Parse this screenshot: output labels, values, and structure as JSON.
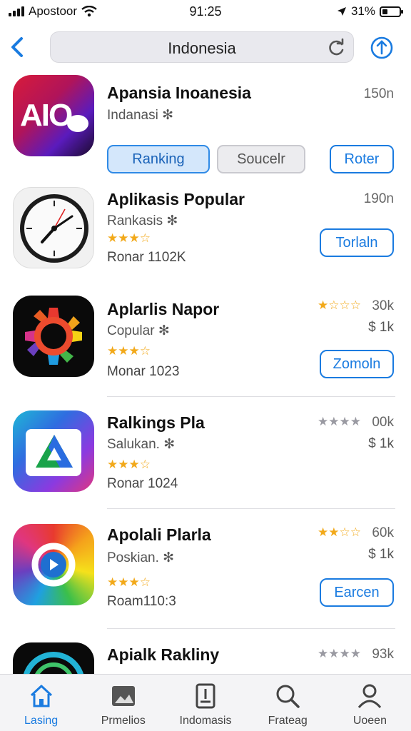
{
  "status_bar": {
    "carrier": "Apostoor",
    "time": "91:25",
    "battery": "31%",
    "battery_level": 0.31
  },
  "nav": {
    "search_value": "Indonesia"
  },
  "colors": {
    "accent": "#1a7be0",
    "star": "#f2a91a"
  },
  "featured": {
    "name": "Apansia Inoanesia",
    "subtitle": "Indanasi ✻",
    "count": "150n",
    "icon_text": "AIO",
    "chips": {
      "ranking": "Ranking",
      "search": "Soucelr",
      "filter": "Roter"
    }
  },
  "apps": [
    {
      "name": "Aplikasis Popular",
      "subtitle": "Rankasis ✻",
      "stars": "★★★☆",
      "meta": "Ronar 1102K",
      "count": "190n",
      "count2": "",
      "rating_stars": "",
      "button": "Torlaln",
      "icon": "clock-icon"
    },
    {
      "name": "Aplarlis Napor",
      "subtitle": "Copular ✻",
      "stars": "★★★☆",
      "meta": "Monar 1023",
      "count": "30k",
      "count2": "$ 1k",
      "rating_stars": "★☆☆☆",
      "button": "Zomoln",
      "icon": "color-gear-icon"
    },
    {
      "name": "Ralkings Pla",
      "subtitle": "Salukan. ✻",
      "stars": "★★★☆",
      "meta": "Ronar 1024",
      "count": "00k",
      "count2": "$ 1k",
      "rating_stars": "★★★★",
      "button": "",
      "icon": "triangle-icon"
    },
    {
      "name": "Apolali Plarla",
      "subtitle": "Poskian. ✻",
      "stars": "★★★☆",
      "meta": "Roam110:3",
      "count": "60k",
      "count2": "$ 1k",
      "rating_stars": "★★☆☆",
      "button": "Earcen",
      "icon": "rainbow-icon"
    },
    {
      "name": "Apialk Rakliny",
      "subtitle": "",
      "stars": "",
      "meta": "",
      "count": "93k",
      "count2": "",
      "rating_stars": "★★★★",
      "button": "",
      "icon": "swirl-icon"
    }
  ],
  "tabs": [
    {
      "label": "Lasing",
      "icon": "home-icon"
    },
    {
      "label": "Prmelios",
      "icon": "photo-icon"
    },
    {
      "label": "Indomasis",
      "icon": "document-icon"
    },
    {
      "label": "Frateag",
      "icon": "search-icon"
    },
    {
      "label": "Uoeen",
      "icon": "person-icon"
    }
  ]
}
